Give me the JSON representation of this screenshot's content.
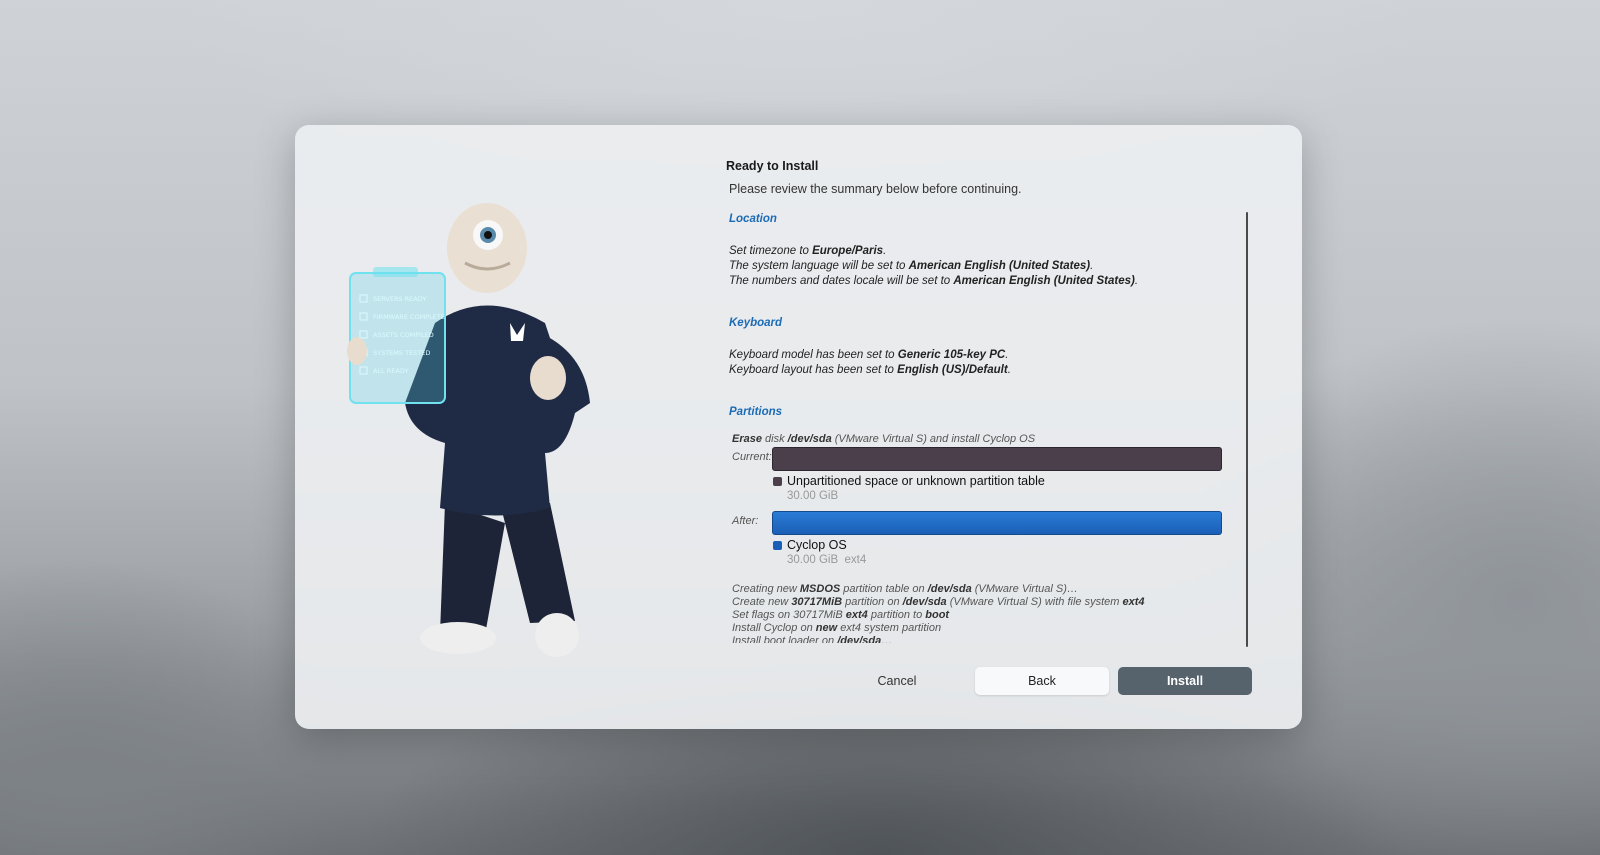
{
  "dialog": {
    "title": "Ready to Install",
    "subtitle": "Please review the summary below before continuing."
  },
  "illustration": {
    "clipboard_items": [
      "SERVERS READY",
      "FIRMWARE COMPLETE",
      "ASSETS COMPILED",
      "SYSTEMS TESTED",
      "ALL READY"
    ]
  },
  "location": {
    "title": "Location",
    "line1_prefix": "Set timezone to ",
    "line1_value": "Europe/Paris",
    "line2_prefix": "The system language will be set to ",
    "line2_value": "American English (United States)",
    "line3_prefix": "The numbers and dates locale will be set to ",
    "line3_value": "American English (United States)"
  },
  "keyboard": {
    "title": "Keyboard",
    "line1_prefix": "Keyboard model has been set to ",
    "line1_value": "Generic 105-key PC",
    "line2_prefix": "Keyboard layout has been set to ",
    "line2_value": "English (US)/Default"
  },
  "partitions": {
    "title": "Partitions",
    "erase_bold": "Erase",
    "erase_mid": " disk ",
    "erase_disk": "/dev/sda",
    "erase_rest": " (VMware Virtual S) and install Cyclop OS",
    "current_label": "Current:",
    "after_label": "After:",
    "current_name": "Unpartitioned space or unknown partition table",
    "current_size": "30.00 GiB",
    "after_name": "Cyclop OS",
    "after_size": "30.00 GiB  ext4",
    "colors": {
      "current": "#4b3f4b",
      "after": "#1a5fb7"
    }
  },
  "operations": {
    "op1_a": "Creating new ",
    "op1_b": "MSDOS",
    "op1_c": " partition table on ",
    "op1_d": "/dev/sda",
    "op1_e": " (VMware Virtual S)…",
    "op2_a": "Create new ",
    "op2_b": "30717MiB",
    "op2_c": " partition on ",
    "op2_d": "/dev/sda",
    "op2_e": " (VMware Virtual S) with file system ",
    "op2_f": "ext4",
    "op3_a": "Set flags on 30717MiB ",
    "op3_b": "ext4",
    "op3_c": " partition to ",
    "op3_d": "boot",
    "op4_a": "Install Cyclop on ",
    "op4_b": "new",
    "op4_c": " ext4 system partition",
    "op5_a": "Install boot loader on ",
    "op5_b": "/dev/sda",
    "op5_c": "…"
  },
  "buttons": {
    "cancel": "Cancel",
    "back": "Back",
    "install": "Install"
  }
}
